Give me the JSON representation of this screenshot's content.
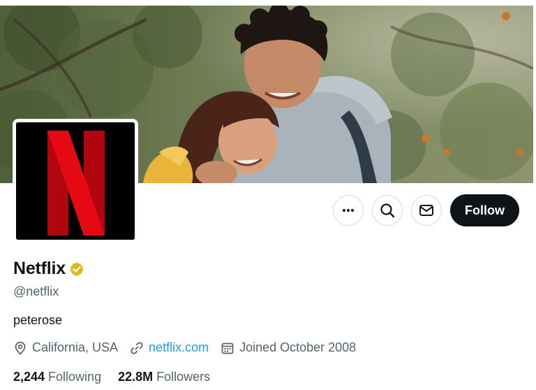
{
  "profile": {
    "display_name": "Netflix",
    "handle": "@netflix",
    "bio": "peterose",
    "verified_badge_color": "#e2b719",
    "banner_description_icon": "photo-banner"
  },
  "actions": {
    "more_icon": "more-dots-icon",
    "search_icon": "search-icon",
    "message_icon": "envelope-icon",
    "follow_label": "Follow"
  },
  "meta": {
    "location": "California, USA",
    "website": "netflix.com",
    "joined": "Joined October 2008",
    "location_icon": "location-pin-icon",
    "link_icon": "link-icon",
    "calendar_icon": "calendar-icon",
    "link_color": "#1d9bf0"
  },
  "stats": {
    "following_count": "2,244",
    "following_label": "Following",
    "followers_count": "22.8M",
    "followers_label": "Followers"
  },
  "colors": {
    "text_primary": "#0f1419",
    "text_secondary": "#536471",
    "netflix_red": "#e50914",
    "button_dark": "#0f1419"
  }
}
